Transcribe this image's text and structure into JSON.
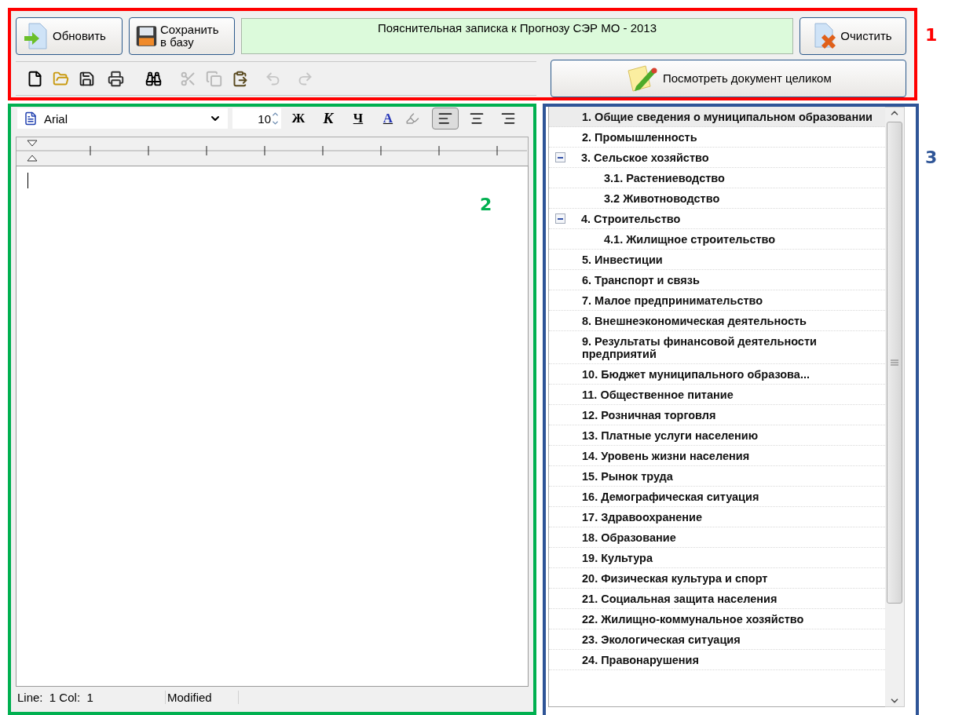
{
  "annotations": [
    {
      "label": "1",
      "color": "#ff0000"
    },
    {
      "label": "2",
      "color": "#00b050"
    },
    {
      "label": "3",
      "color": "#2f5597"
    }
  ],
  "header": {
    "buttons": [
      {
        "kind": "refresh",
        "label": "Обновить"
      },
      {
        "kind": "save",
        "label": "Сохранить в базу"
      }
    ],
    "title": "Пояснительная записка к Прогнозу СЭР МО - 2013",
    "clear_button": "Очистить",
    "view_button": "Посмотреть документ целиком",
    "tools": [
      {
        "kind": "new",
        "disabled": false
      },
      {
        "kind": "open",
        "disabled": false
      },
      {
        "kind": "save",
        "disabled": false
      },
      {
        "kind": "print",
        "disabled": false
      },
      {
        "kind": "find",
        "disabled": false
      },
      {
        "kind": "cut",
        "disabled": true
      },
      {
        "kind": "copy",
        "disabled": true
      },
      {
        "kind": "paste",
        "disabled": false
      },
      {
        "kind": "undo",
        "disabled": true
      },
      {
        "kind": "redo",
        "disabled": true
      }
    ]
  },
  "editor": {
    "font": "Arial",
    "size": "10",
    "styles": [
      {
        "kind": "bold",
        "label": "Ж"
      },
      {
        "kind": "italic",
        "label": "К"
      },
      {
        "kind": "underline",
        "label": "Ч"
      },
      {
        "kind": "color",
        "label": "A"
      }
    ],
    "align": [
      {
        "kind": "left",
        "selected": true
      },
      {
        "kind": "center",
        "selected": false
      },
      {
        "kind": "right",
        "selected": false
      }
    ],
    "status_bar": [
      "Line:  1 Col:  1",
      "Modified"
    ]
  },
  "tree": {
    "items": [
      {
        "label": "1. Общие сведения о муниципальном образовании",
        "selected": true
      },
      {
        "label": "2. Промышленность",
        "selected": false
      },
      {
        "label": "3. Сельское хозяйство",
        "selected": false,
        "expanded": true,
        "children": [
          {
            "label": "3.1. Растениеводство",
            "selected": false
          },
          {
            "label": "3.2 Животноводство",
            "selected": false
          }
        ]
      },
      {
        "label": "4. Строительство",
        "selected": false,
        "expanded": true,
        "children": [
          {
            "label": "4.1. Жилищное строительство",
            "selected": false
          }
        ]
      },
      {
        "label": "5. Инвестиции",
        "selected": false
      },
      {
        "label": "6. Транспорт и связь",
        "selected": false
      },
      {
        "label": "7. Малое предпринимательство",
        "selected": false
      },
      {
        "label": "8. Внешнеэкономическая деятельность",
        "selected": false
      },
      {
        "label": "9. Результаты финансовой деятельности предприятий",
        "selected": false
      },
      {
        "label": "10. Бюджет муниципального образова...",
        "selected": false
      },
      {
        "label": "11. Общественное питание",
        "selected": false
      },
      {
        "label": "12. Розничная торговля",
        "selected": false
      },
      {
        "label": "13. Платные услуги населению",
        "selected": false
      },
      {
        "label": "14. Уровень жизни населения",
        "selected": false
      },
      {
        "label": "15. Рынок труда",
        "selected": false
      },
      {
        "label": "16. Демографическая ситуация",
        "selected": false
      },
      {
        "label": "17. Здравоохранение",
        "selected": false
      },
      {
        "label": "18. Образование",
        "selected": false
      },
      {
        "label": "19. Культура",
        "selected": false
      },
      {
        "label": "20. Физическая культура и спорт",
        "selected": false
      },
      {
        "label": "21. Социальная защита населения",
        "selected": false
      },
      {
        "label": "22. Жилищно-коммунальное хозяйство",
        "selected": false
      },
      {
        "label": "23. Экологическая ситуация",
        "selected": false
      },
      {
        "label": "24. Правонарушения",
        "selected": false
      }
    ]
  }
}
